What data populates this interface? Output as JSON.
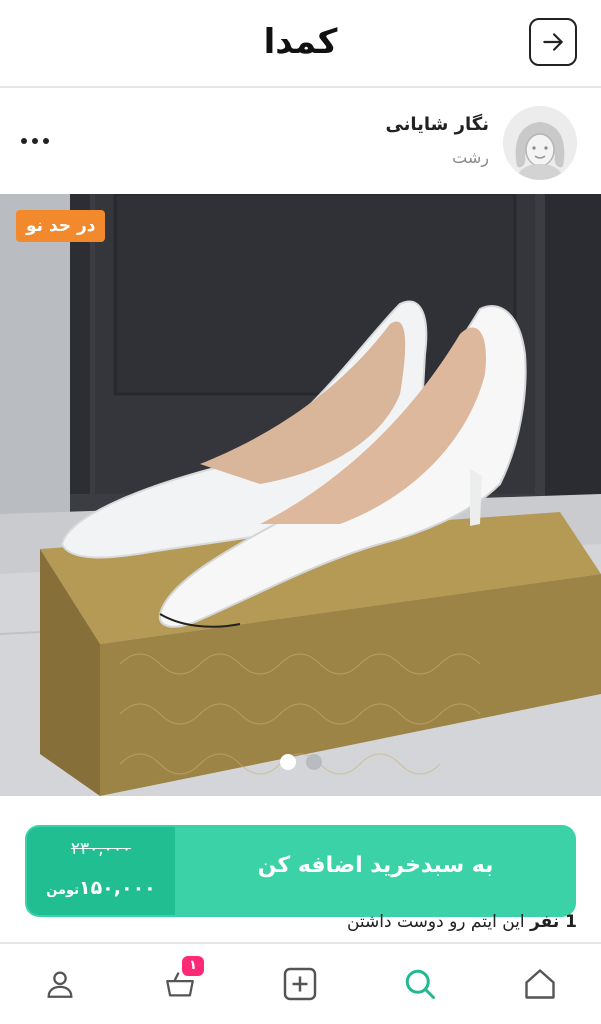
{
  "app": {
    "logo_text": "کمدا"
  },
  "header": {
    "forward_icon": "arrow-right-icon"
  },
  "seller": {
    "name": "نگار شایانی",
    "city": "رشت",
    "more_icon": "more-horizontal-icon",
    "avatar_icon": "avatar-placeholder-icon"
  },
  "product": {
    "condition_badge": "در حد نو",
    "image_alt": "white pointed-toe high heel shoes on a gold shoebox",
    "carousel": {
      "total": 2,
      "active_index": 0
    }
  },
  "cart_bar": {
    "label": "به سبدخرید اضافه کن",
    "old_price": "۲۳۰,۰۰۰",
    "new_price": "۱۵۰,۰۰۰",
    "currency": "تومن"
  },
  "likes": {
    "count": "1 نفر",
    "text": "این ایتم رو دوست داشتن"
  },
  "bottom_nav": {
    "items": [
      {
        "name": "home",
        "icon": "home-icon"
      },
      {
        "name": "search",
        "icon": "search-icon",
        "active": true
      },
      {
        "name": "add",
        "icon": "add-square-icon"
      },
      {
        "name": "cart",
        "icon": "basket-icon",
        "badge": "۱"
      },
      {
        "name": "profile",
        "icon": "user-icon"
      }
    ]
  },
  "colors": {
    "accent": "#3cd2a8",
    "accent_dark": "#21be92",
    "badge_orange": "#f28a2d",
    "cart_badge": "#ff2a77",
    "active_icon": "#22b892"
  }
}
